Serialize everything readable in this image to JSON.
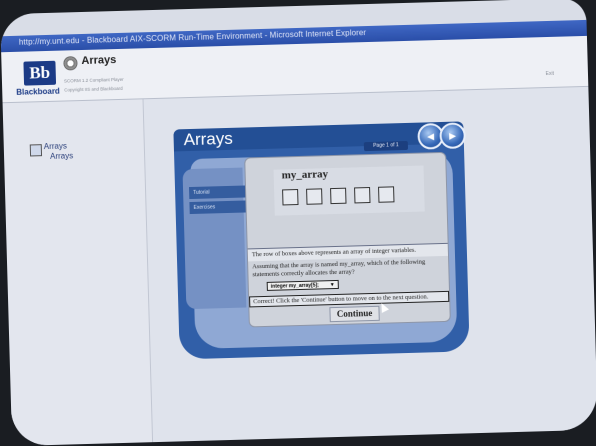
{
  "window": {
    "title": "http://my.unt.edu - Blackboard AIX-SCORM Run-Time Environment - Microsoft Internet Explorer"
  },
  "header": {
    "logo": "Bb",
    "logo_word": "Blackboard",
    "course_title": "Arrays",
    "subtitle1": "SCORM 1.2 Compliant Player",
    "subtitle2": "Copyright IIS and Blackboard",
    "exit_label": "Exit"
  },
  "sidebar": {
    "items": [
      {
        "label": "Arrays"
      },
      {
        "label": "Arrays"
      }
    ]
  },
  "player": {
    "title": "Arrays",
    "page_indicator": "Page 1 of 1",
    "prev_icon": "chevron-left-icon",
    "next_icon": "chevron-right-icon",
    "side_tabs": [
      {
        "label": "Tutorial"
      },
      {
        "label": "Exercises"
      }
    ]
  },
  "question": {
    "array_name": "my_array",
    "cell_count": 5,
    "text1": "The row of boxes above represents an array of integer variables.",
    "text2": "Assuming that the array is named my_array, which of the following statements correctly allocates the array?",
    "selected_answer": "integer my_array[5];",
    "feedback": "Correct! Click the 'Continue' button to move on to the next question.",
    "continue_label": "Continue"
  },
  "colors": {
    "player_blue": "#315fa8",
    "header_blue": "#234f95",
    "titlebar": "#2a4ea8"
  }
}
